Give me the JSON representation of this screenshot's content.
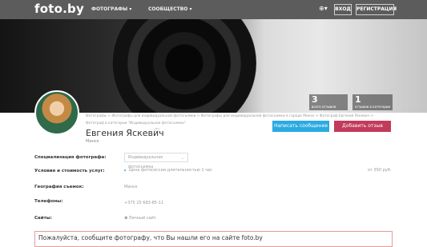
{
  "header": {
    "logo": "foto.by",
    "nav": [
      "ФОТОГРАФЫ ▾",
      "СООБЩЕСТВО ▾"
    ],
    "lang": "⊕▾",
    "login": "ВХОД",
    "register": "РЕГИСТРАЦИЯ"
  },
  "stats": [
    {
      "num": "3",
      "label": "всего отзывов"
    },
    {
      "num": "1",
      "label": "отзывов в категории"
    }
  ],
  "profile": {
    "crumbs": "Фотографы > Фотографы для индивидуальной фотосъемки > Фотографы для индивидуальной фотосъемки в городе Минск > Фотограф Евгения Яскевич >",
    "crumbs2": "Фотограф в категории \"Индивидуальная фотосъемка\"",
    "name": "Евгения Яскевич",
    "city": "Минск",
    "msg_button": "Написать сообщение",
    "review_button": "Добавить отзыв"
  },
  "rows": {
    "specialization_label": "Специализация фотографа:",
    "specialization_value": "Индивидуальная фотосъемка",
    "conditions_label": "Условия и стоимость услуг:",
    "conditions_value": "Цена фотосессии длительностью 1 час",
    "conditions_price": "от 350 руб.",
    "geo_label": "География съемок:",
    "geo_value": "Минск",
    "phones_label": "Телефоны:",
    "phones_value": "+375 25 683-85-11",
    "sites_label": "Сайты:",
    "sites_value": "Личный сайт"
  },
  "notice": "Пожалуйста, сообщите фотографу, что Вы нашли его на сайте foto.by"
}
